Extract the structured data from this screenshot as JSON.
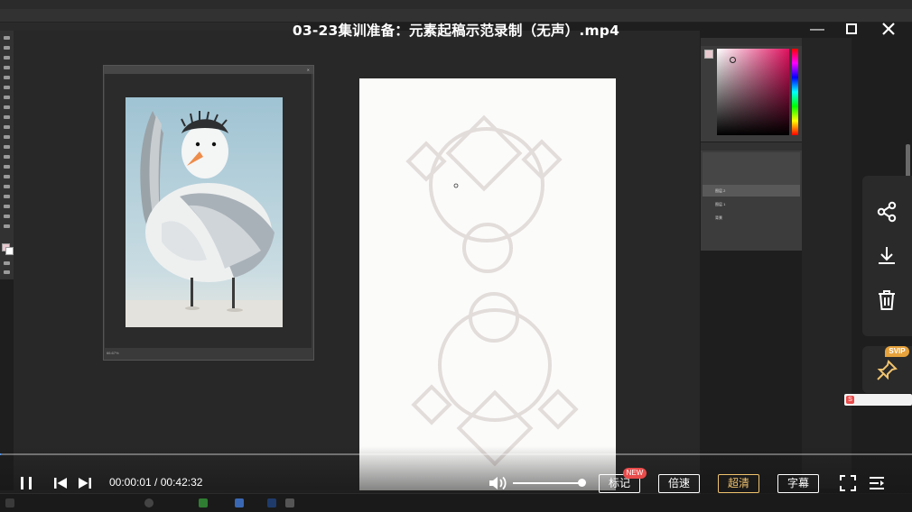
{
  "video": {
    "title": "03-23集训准备：元素起稿示范录制（无声）.mp4",
    "current_time": "00:00:01",
    "total_time": "00:42:32",
    "time_separator": " / ",
    "progress": 0.0004,
    "volume": 1.0,
    "buttons": {
      "mark": "标记",
      "mark_badge": "NEW",
      "speed": "倍速",
      "quality": "超清",
      "subtitle": "字幕"
    },
    "quality_color": "#f0c36e",
    "svip_label": "SVIP"
  },
  "photoshop": {
    "zoom": "66.67%",
    "layers": [
      "图层 2",
      "图层 1",
      "背景"
    ]
  },
  "icons": {
    "share": "share-icon",
    "download": "download-icon",
    "delete": "trash-icon",
    "pin": "pin-icon",
    "pause": "pause-icon",
    "prev": "previous-icon",
    "next": "next-icon",
    "volume": "volume-icon",
    "fullscreen": "fullscreen-icon",
    "playlist": "playlist-icon",
    "minimize": "minimize-icon",
    "maximize": "maximize-icon",
    "close": "close-icon"
  },
  "colors": {
    "accent_red": "#e94b4b",
    "svip_gold": "#e6a23c",
    "canvas_bg": "#fbfbfa",
    "sketch_line": "#e2dcda"
  }
}
